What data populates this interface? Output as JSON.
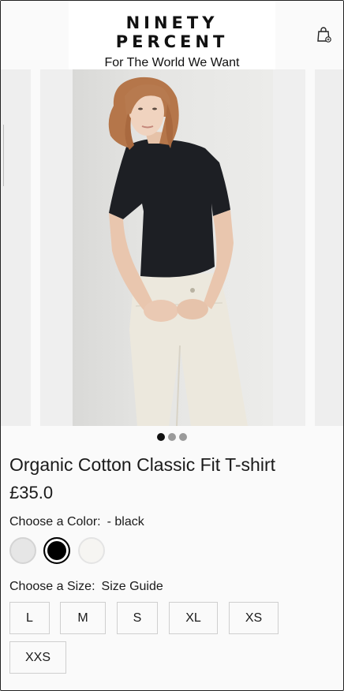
{
  "header": {
    "brand": "NINETY PERCENT",
    "tagline": "For The World We Want",
    "cart_icon": "shopping-bag-icon"
  },
  "carousel": {
    "slides": 3,
    "active_index": 0,
    "image_alt": "Model wearing black organic cotton t-shirt and cream jeans"
  },
  "product": {
    "title": "Organic Cotton Classic Fit T-shirt",
    "price": "£35.0",
    "color_label": "Choose a Color:",
    "color_selected": "- black",
    "colors": [
      {
        "name": "grey",
        "hex": "#e6e6e6"
      },
      {
        "name": "black",
        "hex": "#000000",
        "selected": true
      },
      {
        "name": "white",
        "hex": "#f6f5f2"
      }
    ],
    "size_label": "Choose a Size:",
    "size_guide": "Size Guide",
    "sizes": [
      "L",
      "M",
      "S",
      "XL",
      "XS",
      "XXS"
    ]
  }
}
